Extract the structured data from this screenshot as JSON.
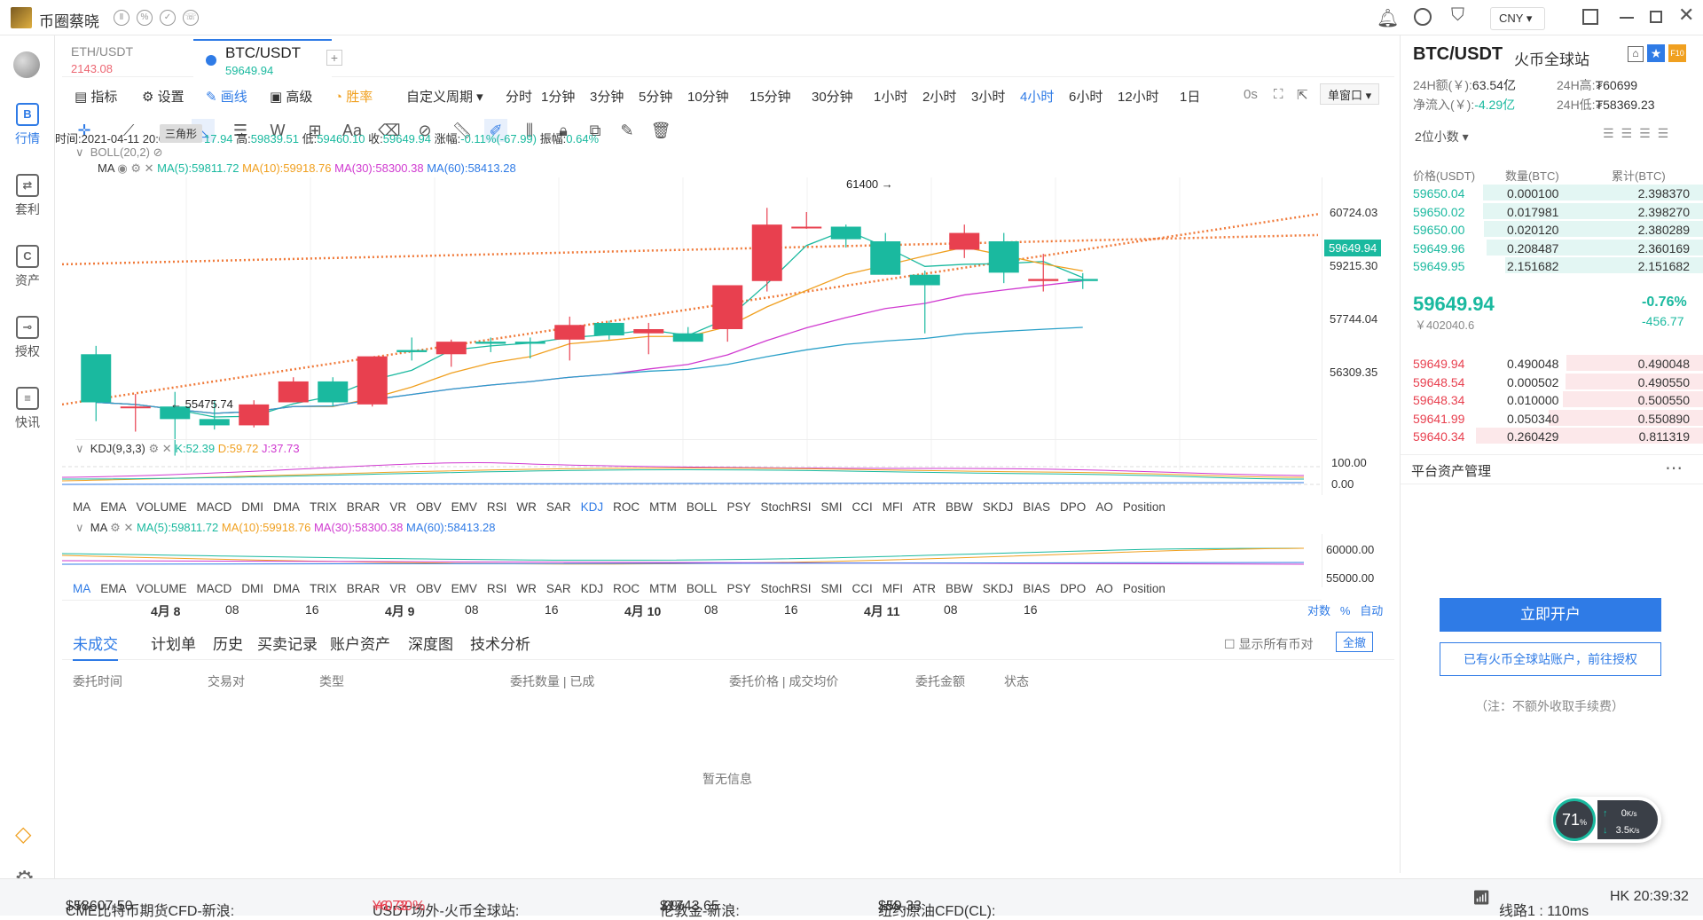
{
  "app": {
    "name": "币圈蔡晓",
    "currency": "CNY"
  },
  "tabs": [
    {
      "pair": "ETH/USDT",
      "price": "2143.08"
    },
    {
      "pair": "BTC/USDT",
      "price": "59649.94"
    }
  ],
  "add_tab": "+",
  "toolbar": {
    "indicators": "指标",
    "settings": "设置",
    "draw": "画线",
    "advanced": "高级",
    "win_rate": "胜率",
    "custom_period": "自定义周期",
    "periods": [
      "分时",
      "1分钟",
      "3分钟",
      "5分钟",
      "10分钟",
      "15分钟",
      "30分钟",
      "1小时",
      "2小时",
      "3小时",
      "4小时",
      "6小时",
      "12小时",
      "1日"
    ],
    "active_period": "4小时",
    "zero_s": "0s",
    "window_mode": "单窗口",
    "tooltip": "三角形"
  },
  "ohlc": {
    "time_label": "时间:",
    "time": "2021-04-11 20:00",
    "open_partial": "17.94",
    "high_label": "高:",
    "high": "59839.51",
    "low_label": "低:",
    "low": "59460.10",
    "close_label": "收:",
    "close": "59649.94",
    "change_label": "涨幅:",
    "change": "-0.11%(-67.99)",
    "amp_label": "振幅:",
    "amp": "0.64%"
  },
  "main_indicators": {
    "boll": "BOLL(20,2)",
    "ma_label": "MA",
    "ma5": "MA(5):59811.72",
    "ma10": "MA(10):59918.76",
    "ma30": "MA(30):58300.38",
    "ma60": "MA(60):58413.28"
  },
  "annotations": {
    "high": "61400 →",
    "low": "← 55475.74"
  },
  "price_axis": [
    "60724.03",
    "59215.30",
    "57744.04",
    "56309.35"
  ],
  "current_price_tag": "59649.94",
  "kdj": {
    "label": "KDJ(9,3,3)",
    "k": "K:52.39",
    "d": "D:59.72",
    "j": "J:37.73",
    "axis": [
      "100.00",
      "0.00"
    ]
  },
  "sub_ma": {
    "label": "MA",
    "ma5": "MA(5):59811.72",
    "ma10": "MA(10):59918.76",
    "ma30": "MA(30):58300.38",
    "ma60": "MA(60):58413.28",
    "axis": [
      "60000.00",
      "55000.00"
    ]
  },
  "indicator_list": [
    "MA",
    "EMA",
    "VOLUME",
    "MACD",
    "DMI",
    "DMA",
    "TRIX",
    "BRAR",
    "VR",
    "OBV",
    "EMV",
    "RSI",
    "WR",
    "SAR",
    "KDJ",
    "ROC",
    "MTM",
    "BOLL",
    "PSY",
    "StochRSI",
    "SMI",
    "CCI",
    "MFI",
    "ATR",
    "BBW",
    "SKDJ",
    "BIAS",
    "DPO",
    "AO",
    "Position"
  ],
  "time_axis": [
    "4月 8",
    "08",
    "16",
    "4月 9",
    "08",
    "16",
    "4月 10",
    "08",
    "16",
    "4月 11",
    "08",
    "16"
  ],
  "axis_controls": {
    "log": "对数",
    "pct": "%",
    "auto": "自动"
  },
  "chart_data": {
    "type": "candlestick",
    "candles": [
      {
        "o": 57900,
        "h": 58100,
        "l": 56300,
        "c": 56750
      },
      {
        "o": 56650,
        "h": 56950,
        "l": 56050,
        "c": 56650
      },
      {
        "o": 56650,
        "h": 57000,
        "l": 55475.74,
        "c": 56350
      },
      {
        "o": 56350,
        "h": 56800,
        "l": 56100,
        "c": 56200
      },
      {
        "o": 56200,
        "h": 56800,
        "l": 56150,
        "c": 56700
      },
      {
        "o": 56750,
        "h": 57350,
        "l": 56750,
        "c": 57250
      },
      {
        "o": 57250,
        "h": 57350,
        "l": 56650,
        "c": 56750
      },
      {
        "o": 56700,
        "h": 57800,
        "l": 56650,
        "c": 57850
      },
      {
        "o": 58000,
        "h": 58300,
        "l": 57750,
        "c": 57950
      },
      {
        "o": 57900,
        "h": 58250,
        "l": 57600,
        "c": 58200
      },
      {
        "o": 58200,
        "h": 58300,
        "l": 57950,
        "c": 58150
      },
      {
        "o": 58200,
        "h": 58300,
        "l": 57800,
        "c": 58150
      },
      {
        "o": 58250,
        "h": 58800,
        "l": 57750,
        "c": 58600
      },
      {
        "o": 58650,
        "h": 58700,
        "l": 58250,
        "c": 58350
      },
      {
        "o": 58400,
        "h": 58650,
        "l": 57900,
        "c": 58500
      },
      {
        "o": 58400,
        "h": 58550,
        "l": 58250,
        "c": 58200
      },
      {
        "o": 58500,
        "h": 59000,
        "l": 58200,
        "c": 59550
      },
      {
        "o": 59650,
        "h": 61400,
        "l": 59400,
        "c": 61000
      },
      {
        "o": 60950,
        "h": 61300,
        "l": 60900,
        "c": 60950
      },
      {
        "o": 60950,
        "h": 61000,
        "l": 60450,
        "c": 60650
      },
      {
        "o": 60600,
        "h": 60800,
        "l": 59800,
        "c": 59800
      },
      {
        "o": 59800,
        "h": 59900,
        "l": 58400,
        "c": 59550
      },
      {
        "o": 60400,
        "h": 61000,
        "l": 60200,
        "c": 60800
      },
      {
        "o": 60600,
        "h": 60800,
        "l": 59600,
        "c": 59850
      },
      {
        "o": 59650,
        "h": 60300,
        "l": 59400,
        "c": 59700
      },
      {
        "o": 59700,
        "h": 59840,
        "l": 59460,
        "c": 59650
      }
    ],
    "ylim": [
      55000,
      62000
    ]
  },
  "bottom_tabs": [
    "未成交",
    "计划单",
    "历史",
    "买卖记录",
    "账户资产",
    "深度图",
    "技术分析"
  ],
  "show_all": "显示所有币对",
  "cancel_all": "全撤",
  "order_columns": [
    "委托时间",
    "交易对",
    "类型",
    "委托数量 | 已成",
    "委托价格 | 成交均价",
    "委托金额",
    "状态"
  ],
  "empty_text": "暂无信息",
  "right": {
    "pair": "BTC/USDT",
    "exchange": "火币全球站",
    "vol_label": "24H额(￥):",
    "vol": "63.54亿",
    "high_label": "24H高:",
    "high": "₮60699",
    "inflow_label": "净流入(￥):",
    "inflow": "-4.29亿",
    "low_label": "24H低:",
    "low": "₮58369.23",
    "decimals": "2位小数",
    "ob_headers": [
      "价格(USDT)",
      "数量(BTC)",
      "累计(BTC)"
    ],
    "bids": [
      [
        "59650.04",
        "0.000100",
        "2.398370"
      ],
      [
        "59650.02",
        "0.017981",
        "2.398270"
      ],
      [
        "59650.00",
        "0.020120",
        "2.380289"
      ],
      [
        "59649.96",
        "0.208487",
        "2.360169"
      ],
      [
        "59649.95",
        "2.151682",
        "2.151682"
      ]
    ],
    "mid_price": "59649.94",
    "mid_cny": "￥402040.6",
    "mid_pct": "-0.76%",
    "mid_chg": "-456.77",
    "asks": [
      [
        "59649.94",
        "0.490048",
        "0.490048"
      ],
      [
        "59648.54",
        "0.000502",
        "0.490550"
      ],
      [
        "59648.34",
        "0.010000",
        "0.500550"
      ],
      [
        "59641.99",
        "0.050340",
        "0.550890"
      ],
      [
        "59640.34",
        "0.260429",
        "0.811319"
      ]
    ],
    "asset_title": "平台资产管理",
    "open_btn": "立即开户",
    "auth_btn": "已有火币全球站账户，前往授权",
    "note": "（注：不额外收取手续费）"
  },
  "net_widget": {
    "pct": "71",
    "up": "0",
    "down": "3.5",
    "unit": "K/s"
  },
  "status": {
    "items": [
      {
        "label": "CME比特币期货CFD-新浪:",
        "value": "$58607.50",
        "chg": "-%"
      },
      {
        "label": "USDT场外-火币全球站:",
        "value": "¥6.73",
        "chg": "+0.30%"
      },
      {
        "label": "伦敦金-新浪:",
        "value": "$1743.65",
        "chg": "0%"
      },
      {
        "label": "纽约原油CFD(CL):",
        "value": "$59.33",
        "chg": "-%"
      }
    ],
    "line": "线路1 : 110ms",
    "clock": "HK 20:39:32"
  },
  "sidebar": [
    "行情",
    "套利",
    "资产",
    "授权",
    "快讯"
  ]
}
